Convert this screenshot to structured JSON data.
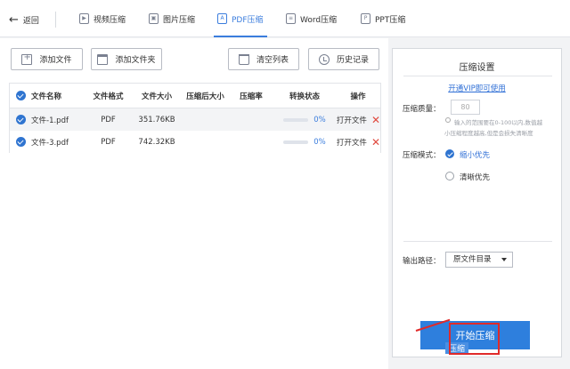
{
  "nav": {
    "back_label": "返回",
    "tabs": [
      {
        "label": "视频压缩",
        "glyph": "▶"
      },
      {
        "label": "图片压缩",
        "glyph": "▣"
      },
      {
        "label": "PDF压缩",
        "glyph": "A"
      },
      {
        "label": "Word压缩",
        "glyph": "≡"
      },
      {
        "label": "PPT压缩",
        "glyph": "P"
      }
    ],
    "active_tab": "PDF压缩"
  },
  "toolbar": {
    "add_file": "添加文件",
    "add_folder": "添加文件夹",
    "clear_list": "清空列表",
    "history": "历史记录"
  },
  "table": {
    "headers": {
      "name": "文件名称",
      "format": "文件格式",
      "size": "文件大小",
      "after_size": "压缩后大小",
      "ratio": "压缩率",
      "status": "转换状态",
      "action": "操作"
    },
    "rows": [
      {
        "name": "文件-1.pdf",
        "format": "PDF",
        "size": "351.76KB",
        "after_size": "",
        "ratio": "",
        "progress": "0%",
        "open": "打开文件"
      },
      {
        "name": "文件-3.pdf",
        "format": "PDF",
        "size": "742.32KB",
        "after_size": "",
        "ratio": "",
        "progress": "0%",
        "open": "打开文件"
      }
    ]
  },
  "settings": {
    "title": "压缩设置",
    "vip_link": "开通VIP即可使用",
    "quality_label": "压缩质量：",
    "quality_value": "80",
    "hint_line1": "输入的范围要在0-100以内,数值越",
    "hint_line2": "小压缩程度越高,但是会损失清晰度",
    "mode_label": "压缩模式：",
    "mode_options": [
      "缩小优先",
      "清晰优先"
    ],
    "mode_selected": "缩小优先",
    "output_label": "输出路径：",
    "output_value": "原文件目录",
    "start_button": "开始压缩",
    "ghost_label": "压缩"
  },
  "colors": {
    "accent": "#3b7ddd",
    "button_blue": "#2e7fdd",
    "delete_red": "#e04a3f",
    "annotation_red": "#e02a2a"
  }
}
